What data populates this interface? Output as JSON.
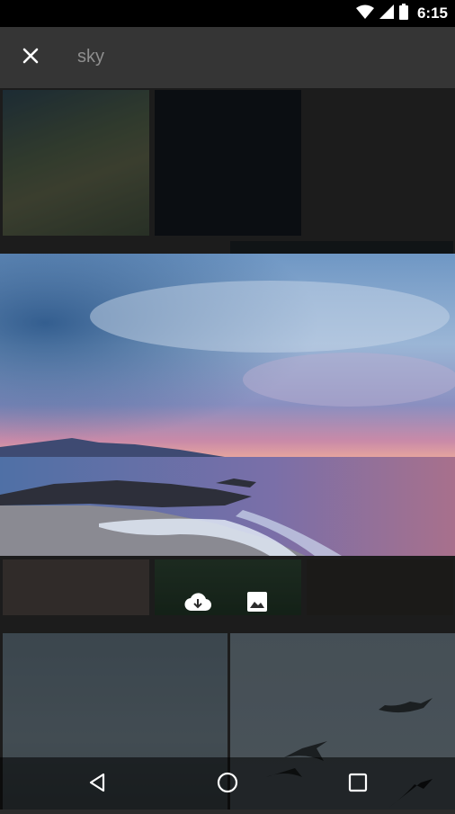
{
  "status_bar": {
    "time": "6:15",
    "icons": [
      "wifi-icon",
      "cell-signal-icon",
      "battery-icon"
    ]
  },
  "app_bar": {
    "close_icon": "close-icon",
    "search_query": "sky"
  },
  "image_actions": {
    "download_icon": "cloud-download-icon",
    "set_wallpaper_icon": "image-icon"
  },
  "nav_bar": {
    "icons": [
      "back-icon",
      "home-icon",
      "recents-icon"
    ]
  },
  "colors": {
    "status_bar": "#000000",
    "app_bar": "#353535",
    "background": "#2b2b2b",
    "icon": "#ffffff"
  }
}
